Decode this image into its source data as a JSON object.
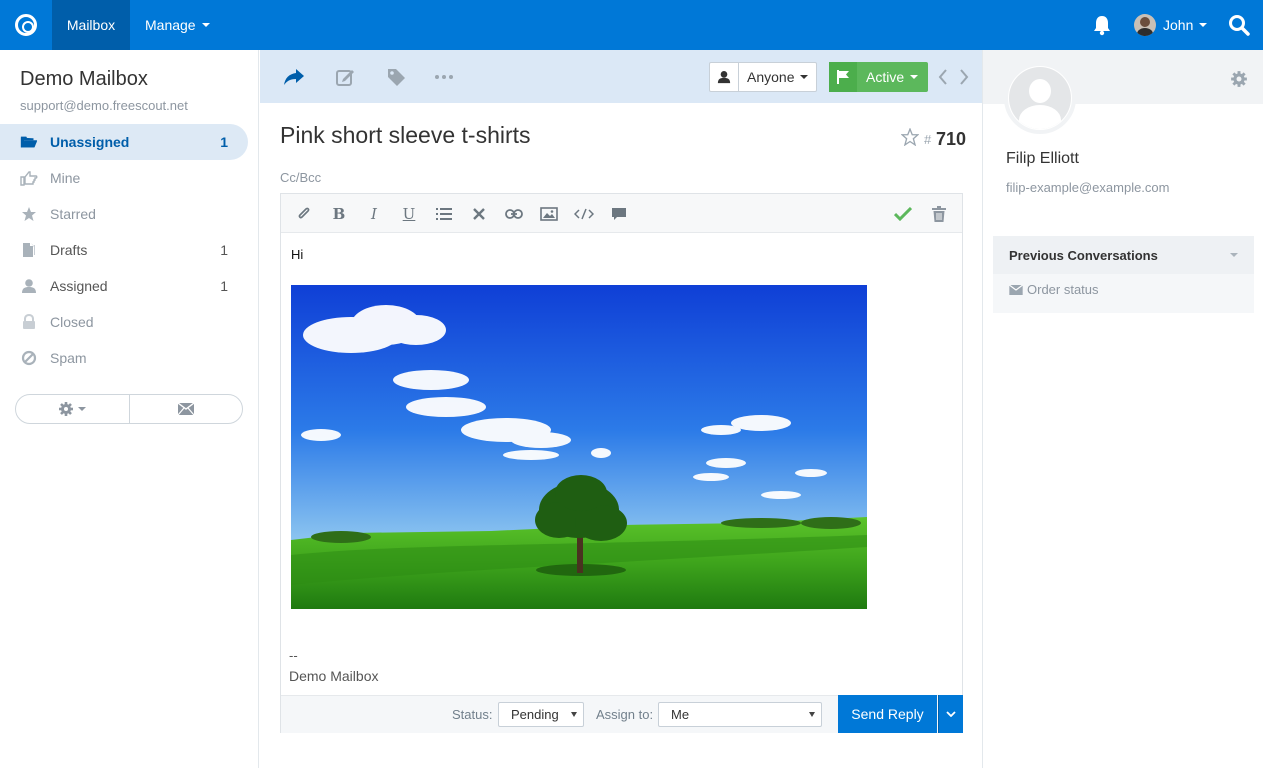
{
  "topnav": {
    "mailbox": "Mailbox",
    "manage": "Manage",
    "user": "John"
  },
  "sidebar": {
    "mailbox_name": "Demo Mailbox",
    "mailbox_email": "support@demo.freescout.net",
    "folders": [
      {
        "label": "Unassigned",
        "count": "1",
        "icon": "folder-open-icon",
        "active": true
      },
      {
        "label": "Mine",
        "count": "",
        "icon": "hand-point-icon",
        "active": false
      },
      {
        "label": "Starred",
        "count": "",
        "icon": "star-icon",
        "active": false
      },
      {
        "label": "Drafts",
        "count": "1",
        "icon": "drafts-icon",
        "active": false
      },
      {
        "label": "Assigned",
        "count": "1",
        "icon": "user-icon",
        "active": false
      },
      {
        "label": "Closed",
        "count": "",
        "icon": "lock-icon",
        "active": false
      },
      {
        "label": "Spam",
        "count": "",
        "icon": "ban-icon",
        "active": false
      }
    ]
  },
  "toolbar": {
    "assignee": "Anyone",
    "status": "Active"
  },
  "conversation": {
    "subject": "Pink short sleeve t-shirts",
    "hash": "#",
    "number": "710",
    "cc_bcc": "Cc/Bcc"
  },
  "editor": {
    "greeting": "Hi",
    "signature_dash": "--",
    "signature": "Demo Mailbox",
    "status_label": "Status:",
    "status_value": "Pending",
    "assign_label": "Assign to:",
    "assign_value": "Me",
    "send_label": "Send Reply"
  },
  "customer": {
    "name": "Filip Elliott",
    "email": "filip-example@example.com",
    "previous_title": "Previous Conversations",
    "previous_item": "Order status"
  },
  "colors": {
    "brand": "#0078d7",
    "active_status": "#5cb85c",
    "toolbar_bg": "#dbe8f6"
  }
}
